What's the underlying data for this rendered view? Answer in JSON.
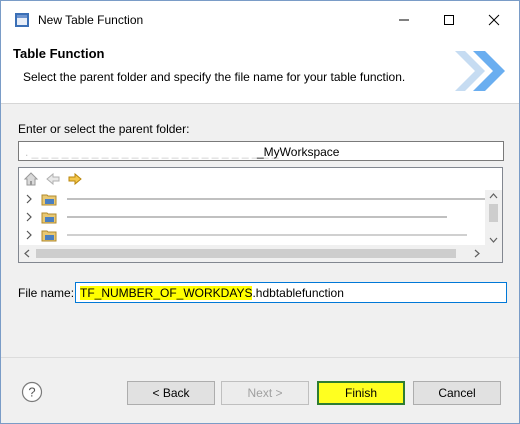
{
  "window": {
    "title": "New Table Function"
  },
  "banner": {
    "title": "Table Function",
    "description": "Select the parent folder and specify the file name for your table function."
  },
  "parent_folder": {
    "label": "Enter or select the parent folder:",
    "value": "_MyWorkspace"
  },
  "tree": {
    "rows": [
      {
        "text": ""
      },
      {
        "text": ""
      },
      {
        "text": ""
      }
    ]
  },
  "file_name": {
    "label": "File name:",
    "highlighted_part": "TF_NUMBER_OF_WORKDAYS",
    "extension": ".hdbtablefunction"
  },
  "buttons": {
    "back": "< Back",
    "next": "Next >",
    "finish": "Finish",
    "cancel": "Cancel"
  },
  "icons": {
    "help": "help-icon",
    "home": "home-icon",
    "nav_back": "back-arrow-icon",
    "nav_forward": "forward-arrow-icon"
  },
  "colors": {
    "highlight": "#ffff00",
    "finish_border": "#2e7d32",
    "focus_border": "#0078d7"
  }
}
